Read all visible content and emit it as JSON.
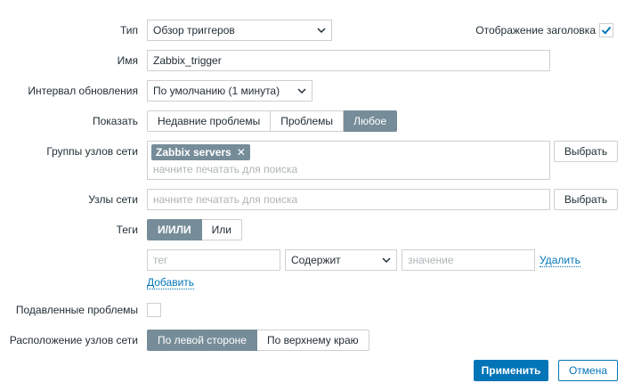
{
  "type": {
    "label": "Тип",
    "value": "Обзор триггеров"
  },
  "show_header": {
    "label": "Отображение заголовка",
    "checked": true
  },
  "name": {
    "label": "Имя",
    "value": "Zabbix_trigger"
  },
  "refresh": {
    "label": "Интервал обновления",
    "value": "По умолчанию (1 минута)"
  },
  "show": {
    "label": "Показать",
    "options": [
      "Недавние проблемы",
      "Проблемы",
      "Любое"
    ],
    "active": "Любое"
  },
  "host_groups": {
    "label": "Группы узлов сети",
    "tag": "Zabbix servers",
    "placeholder": "начните печатать для поиска",
    "select_button": "Выбрать"
  },
  "hosts": {
    "label": "Узлы сети",
    "placeholder": "начните печатать для поиска",
    "select_button": "Выбрать"
  },
  "tags": {
    "label": "Теги",
    "options": [
      "И/ИЛИ",
      "Или"
    ],
    "active": "И/ИЛИ",
    "tag_placeholder": "тег",
    "operator": "Содержит",
    "value_placeholder": "значение",
    "remove_link": "Удалить",
    "add_link": "Добавить"
  },
  "suppressed": {
    "label": "Подавленные проблемы",
    "checked": false
  },
  "hosts_location": {
    "label": "Расположение узлов сети",
    "options": [
      "По левой стороне",
      "По верхнему краю"
    ],
    "active": "По левой стороне"
  },
  "footer": {
    "apply": "Применить",
    "cancel": "Отмена"
  },
  "colors": {
    "accent": "#0275b8",
    "segment_active": "#768d99",
    "border": "#cfcfcf"
  }
}
